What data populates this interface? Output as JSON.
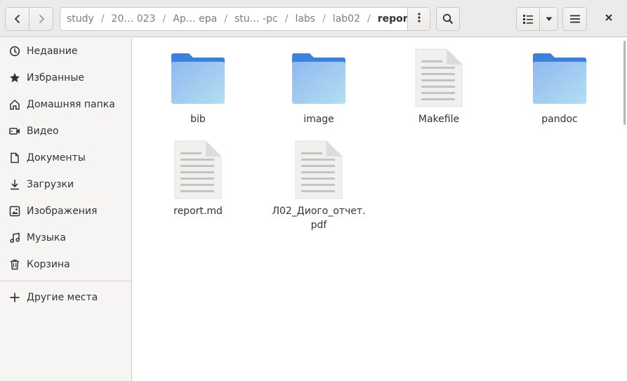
{
  "header": {
    "breadcrumbs": [
      "study",
      "20… 023",
      "Ap… epa",
      "stu… -pc",
      "labs",
      "lab02",
      "report"
    ],
    "current_index": 6
  },
  "sidebar": {
    "items": [
      {
        "label": "Недавние",
        "icon": "clock-icon"
      },
      {
        "label": "Избранные",
        "icon": "star-icon"
      },
      {
        "label": "Домашняя папка",
        "icon": "home-icon"
      },
      {
        "label": "Видео",
        "icon": "video-icon"
      },
      {
        "label": "Документы",
        "icon": "document-icon"
      },
      {
        "label": "Загрузки",
        "icon": "download-icon"
      },
      {
        "label": "Изображения",
        "icon": "image-icon"
      },
      {
        "label": "Музыка",
        "icon": "music-icon"
      },
      {
        "label": "Корзина",
        "icon": "trash-icon"
      }
    ],
    "other_places": {
      "label": "Другие места",
      "icon": "plus-icon"
    }
  },
  "files": [
    {
      "name": "bib",
      "type": "folder"
    },
    {
      "name": "image",
      "type": "folder"
    },
    {
      "name": "Makefile",
      "type": "text-file"
    },
    {
      "name": "pandoc",
      "type": "folder"
    },
    {
      "name": "report.md",
      "type": "text-file"
    },
    {
      "name_line1": "Л02_Диого_отчет.",
      "name_line2": "pdf",
      "type": "text-file"
    }
  ],
  "colors": {
    "folder_front": "#a0c8f0",
    "folder_back": "#3b82db",
    "file_page": "#f0f0ef",
    "accent": "#3584e4"
  }
}
